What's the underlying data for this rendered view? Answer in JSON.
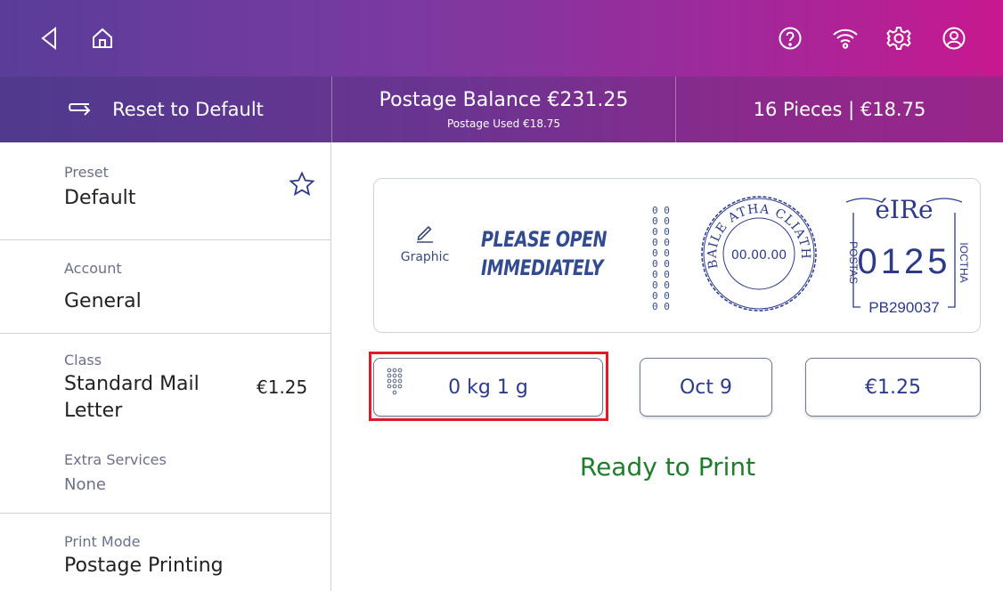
{
  "topbar": {
    "icons": [
      "back-icon",
      "home-icon",
      "help-icon",
      "wifi-icon",
      "settings-icon",
      "account-icon"
    ]
  },
  "actionbar": {
    "reset_label": "Reset to Default",
    "balance_label": "Postage Balance €231.25",
    "used_label": "Postage Used €18.75",
    "pieces_label": "16 Pieces | €18.75"
  },
  "sidebar": {
    "preset": {
      "label": "Preset",
      "value": "Default"
    },
    "account": {
      "label": "Account",
      "value": "General"
    },
    "class": {
      "label": "Class",
      "value_line1": "Standard Mail",
      "value_line2": "Letter",
      "price": "€1.25"
    },
    "extra_services": {
      "label": "Extra Services",
      "value": "None"
    },
    "print_mode": {
      "label": "Print Mode",
      "value": "Postage Printing"
    }
  },
  "indicia": {
    "graphic_label": "Graphic",
    "message_line1": "PLEASE OPEN",
    "message_line2": "IMMEDIATELY",
    "postmark_text": "BAILE ATHA CLIATH",
    "postmark_date": "00.00.00",
    "country": "éIRe",
    "value": "0125",
    "left_vertical": "POSTAS",
    "right_vertical": "IOCTHA",
    "meter_id": "PB290037"
  },
  "controls": {
    "weight": "0 kg 1 g",
    "date": "Oct 9",
    "amount": "€1.25"
  },
  "status": {
    "text": "Ready to Print",
    "color": "#1e7d2a"
  },
  "colors": {
    "accent": "#2d3a8c",
    "highlight": "#e01b24"
  }
}
